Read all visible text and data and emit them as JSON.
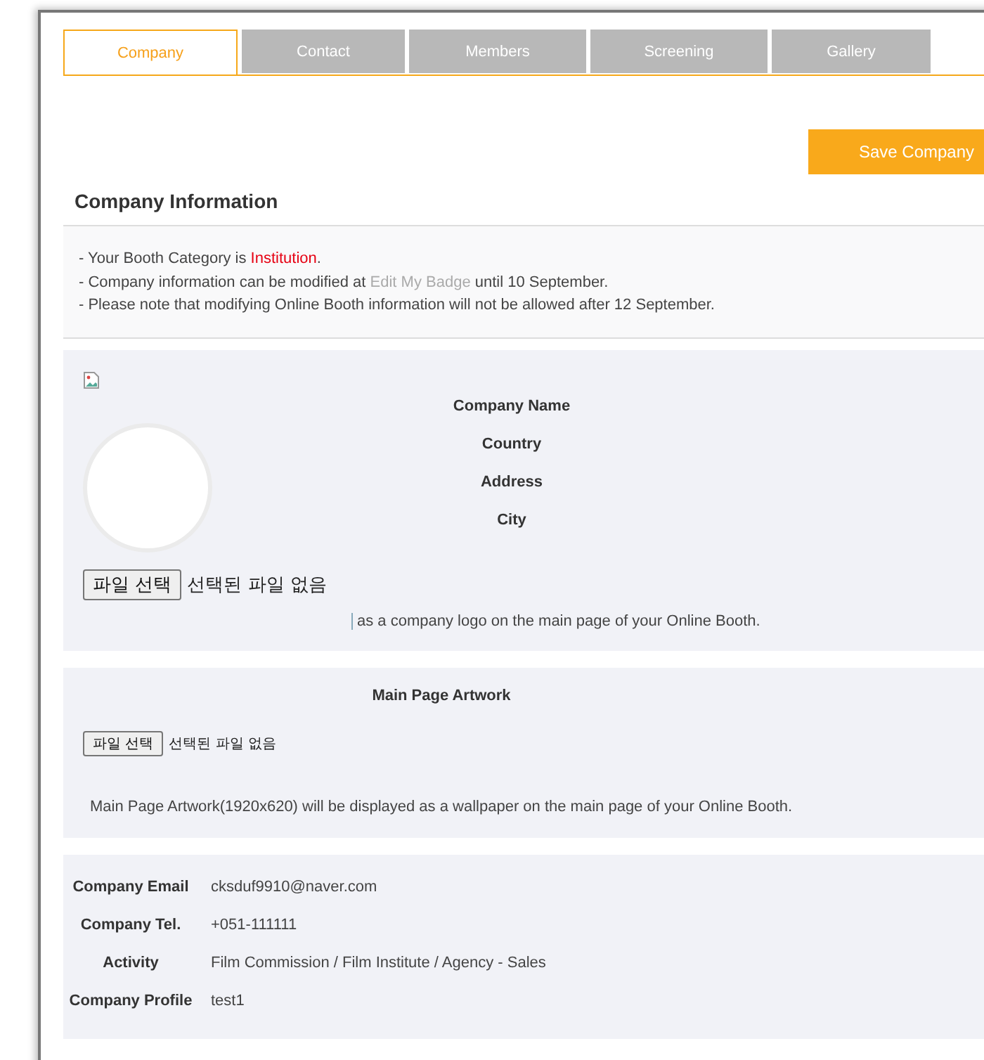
{
  "tabs": [
    {
      "label": "Company",
      "selected": true
    },
    {
      "label": "Contact",
      "selected": false
    },
    {
      "label": "Members",
      "selected": false
    },
    {
      "label": "Screening",
      "selected": false
    },
    {
      "label": "Gallery",
      "selected": false
    }
  ],
  "save_button": "Save Company",
  "section_title": "Company Information",
  "notes": [
    [
      {
        "kind": "plain",
        "text": "- Your Booth Category is "
      },
      {
        "kind": "highlight",
        "text": "Institution"
      },
      {
        "kind": "plain",
        "text": "."
      }
    ],
    [
      {
        "kind": "plain",
        "text": "- Company information can be modified at "
      },
      {
        "kind": "link",
        "text": "Edit My Badge"
      },
      {
        "kind": "plain",
        "text": " until 10 September."
      }
    ],
    [
      {
        "kind": "plain",
        "text": "- Please note that modifying Online Booth information will not be allowed after 12 September."
      }
    ]
  ],
  "logo_section": {
    "fields": [
      "Company Name",
      "Country",
      "Address",
      "City"
    ],
    "file_button": "파일 선택",
    "file_status": "선택된 파일 없음",
    "note": "as a company logo on the main page of your Online Booth."
  },
  "artwork_section": {
    "title": "Main Page Artwork",
    "file_button": "파일 선택",
    "file_status": "선택된 파일 없음",
    "note": "Main Page Artwork(1920x620) will be displayed as a wallpaper on the main page of your Online Booth."
  },
  "details": [
    {
      "label": "Company Email",
      "value": "cksduf9910@naver.com"
    },
    {
      "label": "Company Tel.",
      "value": "+051-111111"
    },
    {
      "label": "Activity",
      "value": "Film Commission / Film Institute / Agency - Sales"
    },
    {
      "label": "Company Profile",
      "value": "test1"
    }
  ]
}
